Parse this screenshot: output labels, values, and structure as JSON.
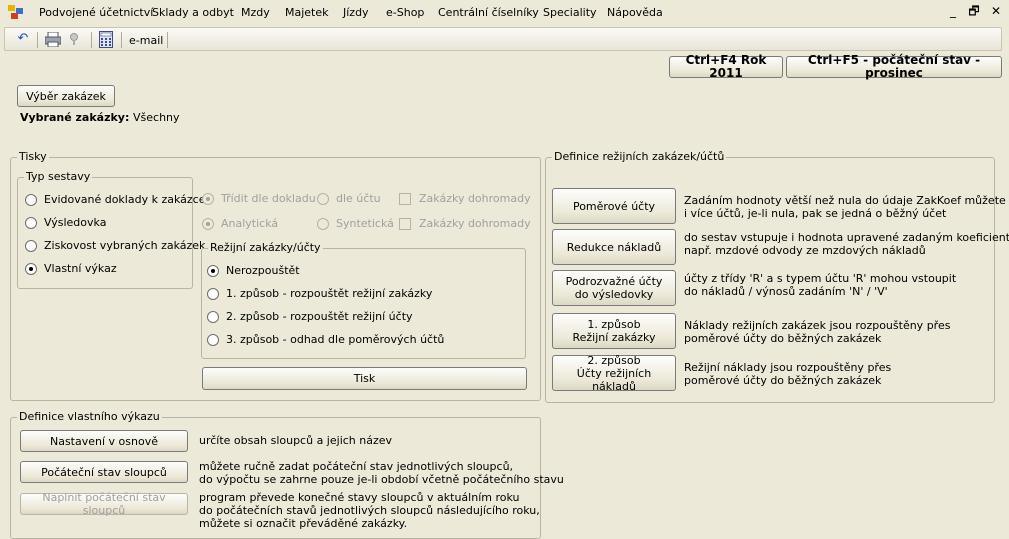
{
  "menu": {
    "items": [
      "Podvojené účetnictví",
      "Sklady a odbyt",
      "Mzdy",
      "Majetek",
      "Jízdy",
      "e-Shop",
      "Centrální číselníky",
      "Speciality",
      "Nápověda"
    ]
  },
  "window_controls": {
    "minimize": "_",
    "restore": "🗗",
    "close": "✕"
  },
  "toolbar": {
    "icons": [
      "undo-icon",
      "print-icon",
      "help-icon",
      "calculator-icon"
    ],
    "email_label": "e-mail"
  },
  "header_buttons": {
    "year": "Ctrl+F4 Rok 2011",
    "initial_state": "Ctrl+F5 - počáteční stav - prosinec"
  },
  "orders": {
    "select_button": "Výběr zakázek",
    "selected_label": "Vybrané zakázky:",
    "selected_value": "Všechny"
  },
  "prints": {
    "title": "Tisky",
    "report_type": {
      "title": "Typ sestavy",
      "options": [
        "Evidované doklady k zakázce",
        "Výsledovka",
        "Ziskovost vybraných zakázek",
        "Vlastní výkaz"
      ],
      "selected_index": 3
    },
    "sort_options": {
      "by_document": "Třídit dle dokladu",
      "by_account": "dle účtu",
      "merge_orders_1": "Zakázky dohromady",
      "analytic": "Analytická",
      "synthetic": "Syntetická",
      "merge_orders_2": "Zakázky dohromady"
    },
    "overhead": {
      "title": "Režijní zakázky/účty",
      "options": [
        "Nerozpouštět",
        "1. způsob - rozpouštět režijní zakázky",
        "2. způsob - rozpouštět režijní účty",
        "3. způsob - odhad dle poměrových účtů"
      ],
      "selected_index": 0
    },
    "print_button": "Tisk"
  },
  "own_report": {
    "title": "Definice vlastního výkazu",
    "rows": [
      {
        "button": "Nastavení v osnově",
        "desc": [
          "určíte obsah sloupců a jejich název"
        ],
        "enabled": true
      },
      {
        "button": "Počáteční stav sloupců",
        "desc": [
          "můžete ručně zadat počáteční stav jednotlivých sloupců,",
          "do výpočtu se zahrne pouze je-li období včetně počátečního stavu"
        ],
        "enabled": true
      },
      {
        "button": "Naplnit počáteční stav sloupců",
        "desc": [
          "program převede konečné stavy sloupců v aktuálním roku",
          "do počátečních stavů jednotlivých sloupců následujícího roku,",
          "můžete si označit převáděné zakázky."
        ],
        "enabled": false
      }
    ]
  },
  "overhead_def": {
    "title": "Definice režijních zakázek/účtů",
    "rows": [
      {
        "button": [
          "Poměrové účty"
        ],
        "desc": [
          "Zadáním hodnoty větší než nula do údaje ZakKoef můžete určit",
          "i více účtů, je-li nula, pak se jedná o běžný účet"
        ]
      },
      {
        "button": [
          "Redukce nákladů"
        ],
        "desc": [
          "do sestav vstupuje i hodnota upravené zadaným koeficientem",
          "např. mzdové odvody ze mzdových nákladů"
        ]
      },
      {
        "button": [
          "Podrozvažné účty",
          "do výsledovky"
        ],
        "desc": [
          "účty z třídy 'R' a s typem účtu 'R' mohou vstoupit",
          "do nákladů / výnosů zadáním 'N' / 'V'"
        ]
      },
      {
        "button": [
          "1. způsob",
          "Režijní zakázky"
        ],
        "desc": [
          "Náklady režijních zakázek jsou rozpouštěny přes",
          "poměrové účty do běžných zakázek"
        ]
      },
      {
        "button": [
          "2. způsob",
          "Účty režijních nákladů"
        ],
        "desc": [
          "Režijní náklady jsou rozpouštěny přes",
          "poměrové účty do běžných zakázek"
        ]
      }
    ]
  }
}
